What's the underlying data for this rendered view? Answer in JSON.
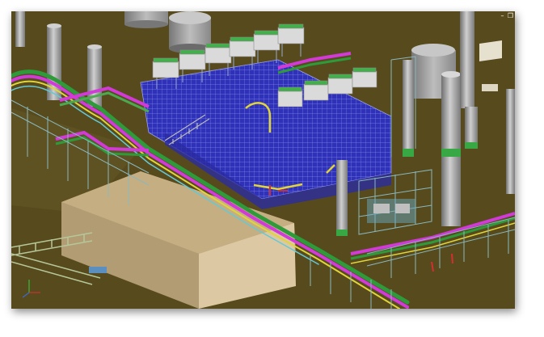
{
  "window": {
    "controls": [
      {
        "name": "minimize",
        "glyph": "–"
      },
      {
        "name": "restore",
        "glyph": "❐"
      }
    ]
  },
  "scene": {
    "labels": {
      "building_sign": "",
      "small_sign": ""
    },
    "colors": {
      "ground": "#574a1d",
      "grating": "#3a3cc8",
      "steel": "#8ab8bf",
      "pipe_magenta": "#d23ad8",
      "pipe_green": "#2f9a3a",
      "pipe_yellow": "#e0d43a",
      "vessel": "#a9a9a9",
      "building": "#c2ab7e"
    }
  }
}
